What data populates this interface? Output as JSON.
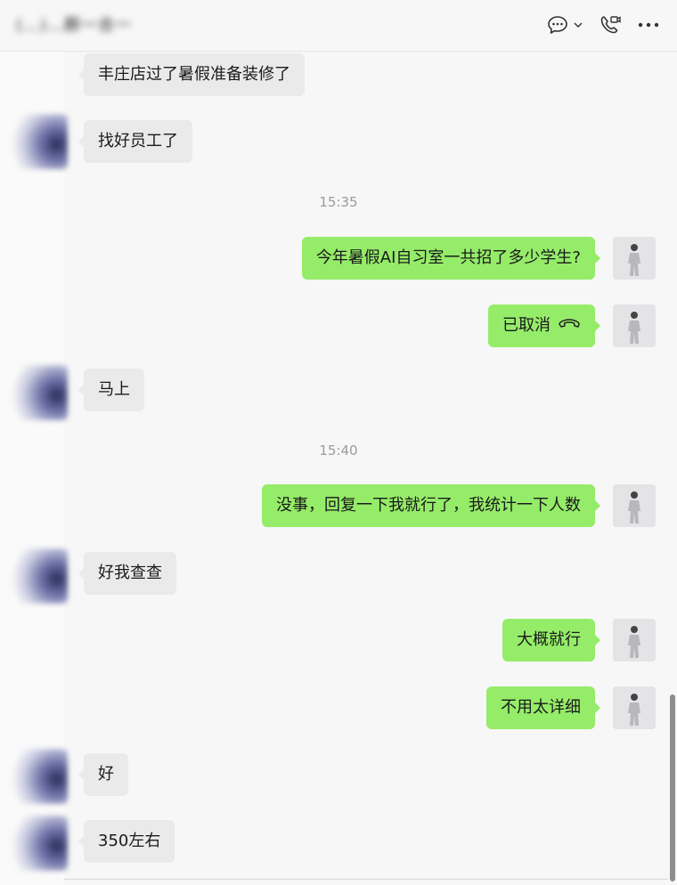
{
  "header": {
    "title": "(…)…群一合一",
    "icons": [
      "chat-bubble-icon",
      "chevron-down-icon",
      "video-call-icon",
      "more-icon"
    ]
  },
  "colors": {
    "outgoing_bubble": "#95ec69",
    "incoming_bubble": "#eaeaea",
    "timestamp_text": "#9b9b9b"
  },
  "messages": {
    "m1": {
      "direction": "in",
      "text": "丰庄店过了暑假准备装修了"
    },
    "m2": {
      "direction": "in",
      "text": "找好员工了"
    },
    "t1": "15:35",
    "m3": {
      "direction": "out",
      "text": "今年暑假AI自习室一共招了多少学生?"
    },
    "m4": {
      "direction": "out",
      "text": "已取消",
      "icon": "hang-up-icon"
    },
    "m5": {
      "direction": "in",
      "text": "马上"
    },
    "t2": "15:40",
    "m6": {
      "direction": "out",
      "text": "没事，回复一下我就行了，我统计一下人数"
    },
    "m7": {
      "direction": "in",
      "text": "好我查查"
    },
    "m8": {
      "direction": "out",
      "text": "大概就行"
    },
    "m9": {
      "direction": "out",
      "text": "不用太详细"
    },
    "m10": {
      "direction": "in",
      "text": "好"
    },
    "m11": {
      "direction": "in",
      "text": "350左右"
    }
  }
}
